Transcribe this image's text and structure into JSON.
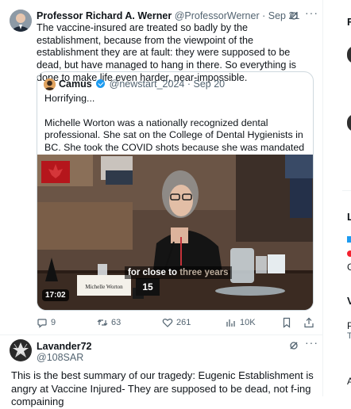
{
  "post1": {
    "name": "Professor Richard A. Werner",
    "handle": "@ProfessorWerner",
    "time": "· Sep 21",
    "text": "The vaccine-insured are treated so badly by the establishment, because from the viewpoint of the establishment they are at fault: they were supposed to be dead, but have managed to hang in there. So everything is done to make life even harder, near-impossible.",
    "quote": {
      "name": "Camus",
      "handle": "@newstart_2024",
      "time": "· Sep 20",
      "line1": "Horrifying...",
      "body": "Michelle Worton was a nationally recognized dental professional. She sat on the College of Dental Hygienists in BC. She took the COVID shots because she was mandated to as a regulated healthcare ...",
      "video": {
        "caption_main": "for close to",
        "caption_faint": "three years",
        "nameplate": "Michelle Worton",
        "number": "15",
        "duration": "17:02"
      }
    },
    "actions": {
      "replies": "9",
      "reposts": "63",
      "likes": "261",
      "views": "10K"
    }
  },
  "post2": {
    "name": "Lavander72",
    "handle": "@108SAR",
    "text": "This is the best summary of our tragedy: Eugenic Establishment is angry at Vaccine Injured- They are supposed to be dead, not f-ing compaining"
  },
  "right_rail": {
    "letters": [
      "F",
      "L",
      "G",
      "V",
      "P",
      "T",
      "A"
    ]
  }
}
